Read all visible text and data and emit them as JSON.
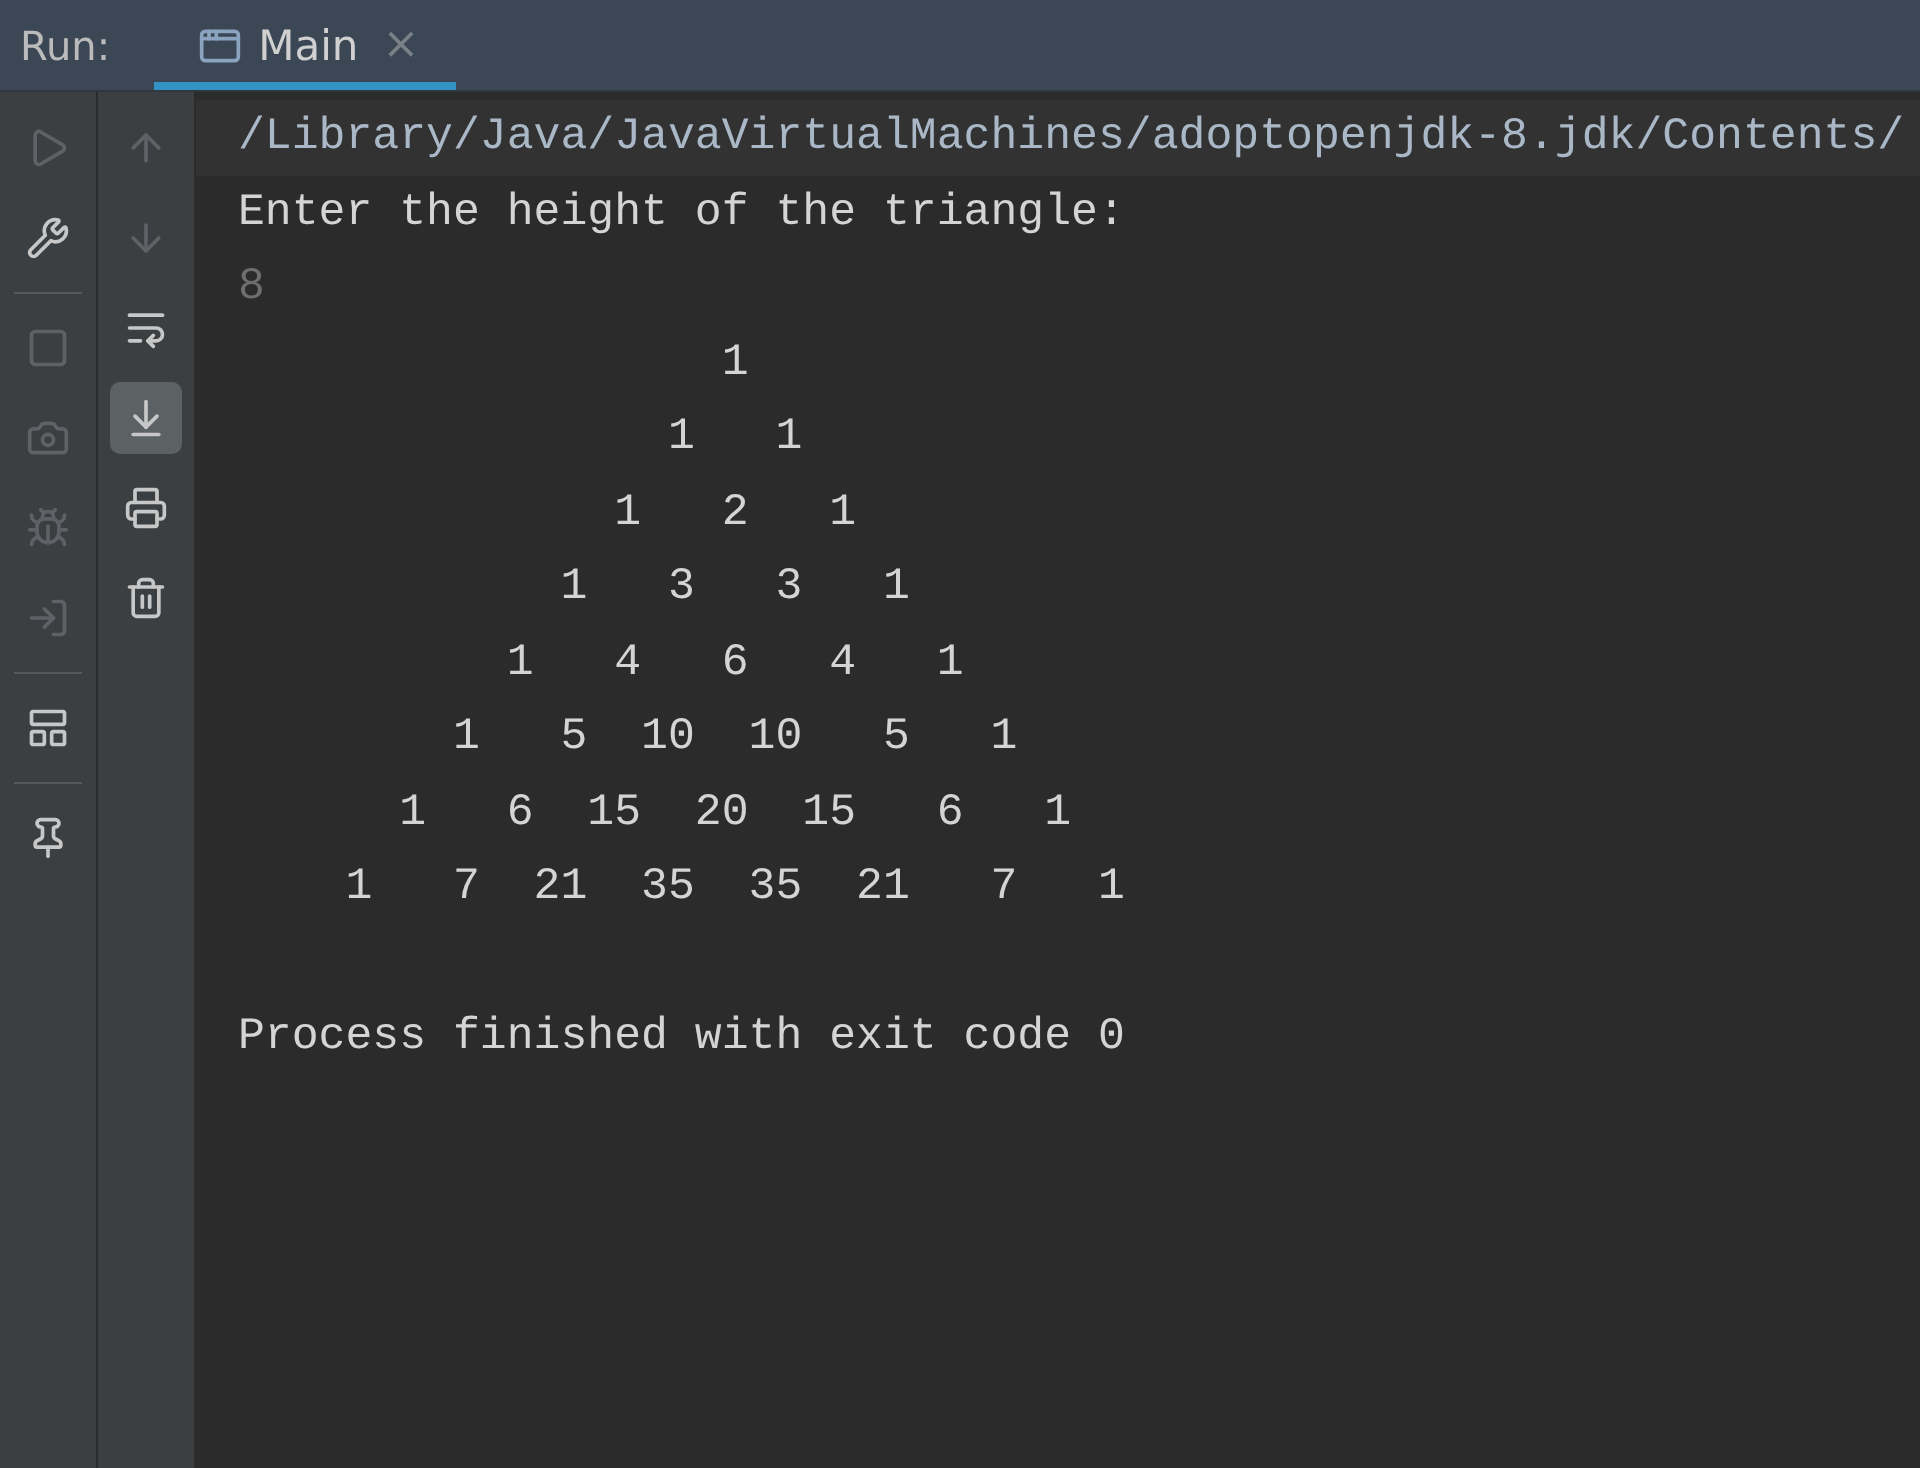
{
  "run_panel": {
    "label": "Run:"
  },
  "tabs": [
    {
      "label": "Main",
      "selected": true,
      "close": "×"
    }
  ],
  "left_toolbar": [
    {
      "disabled": true
    },
    {
      "disabled": false
    },
    {
      "disabled": true
    },
    {
      "disabled": true
    },
    {
      "disabled": true
    },
    {
      "disabled": true
    },
    {
      "disabled": false
    },
    {
      "disabled": false
    }
  ],
  "console_toolbar": [
    {
      "disabled": true,
      "selected": false
    },
    {
      "disabled": true,
      "selected": false
    },
    {
      "disabled": false,
      "selected": false
    },
    {
      "disabled": false,
      "selected": true
    },
    {
      "disabled": false,
      "selected": false
    },
    {
      "disabled": false,
      "selected": false
    }
  ],
  "console": [
    {
      "kind": "command",
      "text": "/Library/Java/JavaVirtualMachines/adoptopenjdk-8.jdk/Contents/"
    },
    {
      "kind": "output",
      "text": "Enter the height of the triangle:"
    },
    {
      "kind": "input",
      "text": "8"
    },
    {
      "kind": "output",
      "text": "                  1"
    },
    {
      "kind": "output",
      "text": "                1   1"
    },
    {
      "kind": "output",
      "text": "              1   2   1"
    },
    {
      "kind": "output",
      "text": "            1   3   3   1"
    },
    {
      "kind": "output",
      "text": "          1   4   6   4   1"
    },
    {
      "kind": "output",
      "text": "        1   5  10  10   5   1"
    },
    {
      "kind": "output",
      "text": "      1   6  15  20  15   6   1"
    },
    {
      "kind": "output",
      "text": "    1   7  21  35  35  21   7   1"
    },
    {
      "kind": "blank"
    },
    {
      "kind": "output",
      "text": "Process finished with exit code 0"
    }
  ]
}
